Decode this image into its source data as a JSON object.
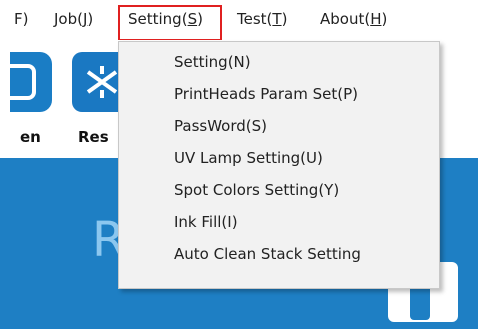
{
  "menubar": {
    "file": {
      "text": "F)",
      "short": "",
      "close": ""
    },
    "job": {
      "text": "Job(",
      "key": "J",
      "close": ")"
    },
    "setting": {
      "text": "Setting(",
      "key": "S",
      "close": ")"
    },
    "test": {
      "text": "Test(",
      "key": "T",
      "close": ")"
    },
    "about": {
      "text": "About(",
      "key": "H",
      "close": ")"
    }
  },
  "toolbar": {
    "items": [
      {
        "label": "en",
        "icon": "open-icon"
      },
      {
        "label": "Res",
        "icon": "reset-icon"
      }
    ]
  },
  "panel": {
    "letter": "R"
  },
  "dropdown": {
    "items": [
      {
        "label": "Setting(N)"
      },
      {
        "label": "PrintHeads Param Set(P)"
      },
      {
        "label": "PassWord(S)"
      },
      {
        "label": "UV Lamp Setting(U)"
      },
      {
        "label": "Spot Colors Setting(Y)"
      },
      {
        "label": "Ink Fill(I)"
      },
      {
        "label": "Auto Clean Stack Setting"
      }
    ]
  },
  "colors": {
    "accent": "#1e7fc4",
    "highlight": "#e02020",
    "menu_bg": "#f2f2f2"
  }
}
